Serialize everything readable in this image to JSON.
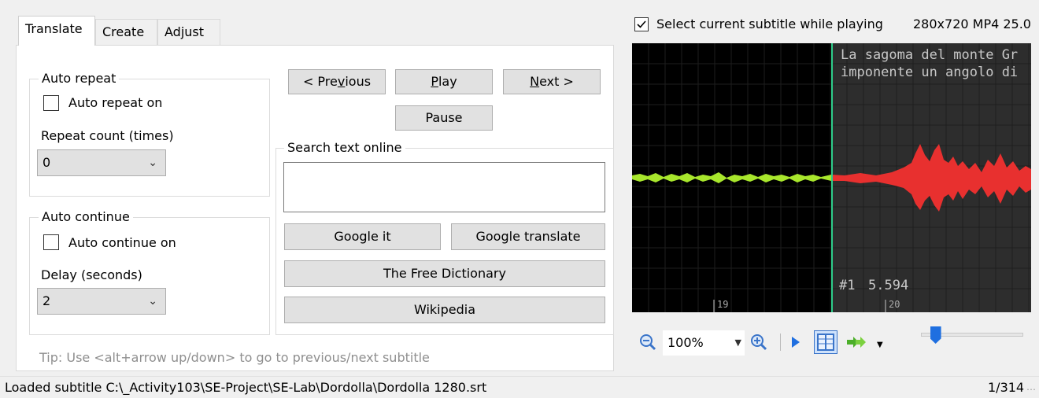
{
  "tabs": [
    {
      "label": "Translate",
      "active": true
    },
    {
      "label": "Create",
      "active": false
    },
    {
      "label": "Adjust",
      "active": false
    }
  ],
  "auto_repeat": {
    "group_label": "Auto repeat",
    "checkbox_label": "Auto repeat on",
    "checked": false,
    "count_label": "Repeat count (times)",
    "count_value": "0"
  },
  "auto_continue": {
    "group_label": "Auto continue",
    "checkbox_label": "Auto continue on",
    "checked": false,
    "delay_label": "Delay (seconds)",
    "delay_value": "2"
  },
  "playback": {
    "previous_prefix": "< Pre",
    "previous_mnemonic": "v",
    "previous_suffix": "ious",
    "play_mnemonic": "P",
    "play_suffix": "lay",
    "next_mnemonic": "N",
    "next_suffix": "ext >",
    "pause_label": "Pause"
  },
  "search": {
    "group_label": "Search text online",
    "input_value": "",
    "google_it": "Google it",
    "google_translate": "Google translate",
    "free_dictionary": "The Free Dictionary",
    "wikipedia": "Wikipedia"
  },
  "tip": "Tip: Use <alt+arrow up/down> to go to previous/next subtitle",
  "video": {
    "select_while_playing_label": "Select current subtitle while playing",
    "select_while_playing_checked": true,
    "media_info": "280x720 MP4 25.0"
  },
  "waveform": {
    "subtitle_line_1": "La sagoma del monte Gr",
    "subtitle_line_2": "imponente un angolo di",
    "subtitle_number": "#1",
    "subtitle_duration": "5.594",
    "tick_labels": [
      "19",
      "20"
    ],
    "colors": {
      "background": "#000000",
      "selected_background": "#2d2d2d",
      "wave_before": "#a8e62c",
      "wave_selected": "#e8302f",
      "cursor_line": "#2ecc8a"
    }
  },
  "toolbar": {
    "zoom_value": "100%",
    "icons": [
      "zoom-out-icon",
      "zoom-in-icon",
      "play-icon",
      "split-icon",
      "forward-icon"
    ],
    "slider_value": 0.1
  },
  "status": {
    "message": "Loaded subtitle C:\\_Activity103\\SE-Project\\SE-Lab\\Dordolla\\Dordolla 1280.srt",
    "position": "1/314"
  }
}
